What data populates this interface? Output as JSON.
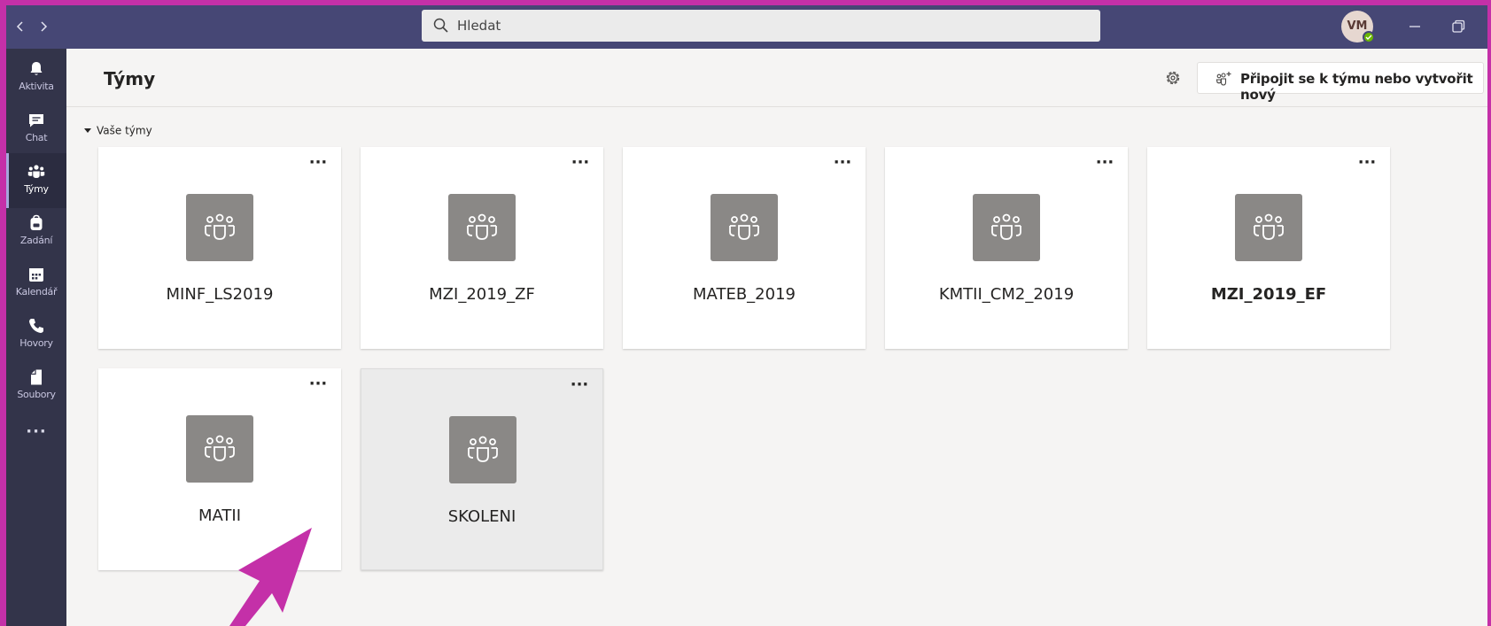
{
  "titlebar": {
    "back_icon": "chevron-left-icon",
    "forward_icon": "chevron-right-icon",
    "search_placeholder": "Hledat",
    "avatar_initials": "VM",
    "presence_color": "#6bb700"
  },
  "rail": {
    "items": [
      {
        "label": "Aktivita",
        "icon": "bell-icon"
      },
      {
        "label": "Chat",
        "icon": "chat-icon"
      },
      {
        "label": "Týmy",
        "icon": "teams-icon",
        "active": true
      },
      {
        "label": "Zadání",
        "icon": "backpack-icon"
      },
      {
        "label": "Kalendář",
        "icon": "calendar-icon"
      },
      {
        "label": "Hovory",
        "icon": "phone-icon"
      },
      {
        "label": "Soubory",
        "icon": "file-icon"
      }
    ],
    "more": "···"
  },
  "header": {
    "title": "Týmy",
    "join_label": "Připojit se k týmu nebo vytvořit nový"
  },
  "section": {
    "label": "Vaše týmy"
  },
  "teams": [
    {
      "name": "MINF_LS2019",
      "bold": false
    },
    {
      "name": "MZI_2019_ZF",
      "bold": false
    },
    {
      "name": "MATEB_2019",
      "bold": false
    },
    {
      "name": "KMTII_CM2_2019",
      "bold": false
    },
    {
      "name": "MZI_2019_EF",
      "bold": true
    },
    {
      "name": "MATII",
      "bold": false
    },
    {
      "name": "SKOLENI",
      "bold": false,
      "hover": true
    }
  ],
  "card_more": "···",
  "colors": {
    "titlebar": "#464775",
    "rail": "#33344a",
    "accent": "#a6a7dc",
    "frame_border": "#c430a8",
    "arrow": "#c430a8"
  }
}
